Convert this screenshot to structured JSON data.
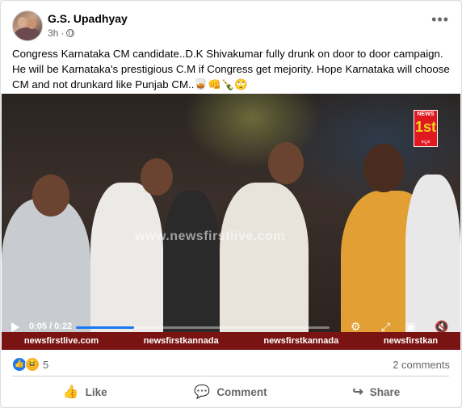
{
  "post": {
    "author": "G.S. Upadhyay",
    "time": "3h",
    "dot": "·",
    "text": "Congress Karnataka CM candidate..D.K Shivakumar fully drunk on door to door campaign. He will be Karnataka's prestigious C.M if Congress get mejority. Hope Karnataka will choose  CM and not drunkard like Punjab CM..🥃👊🍾🙄"
  },
  "video": {
    "watermark": "www.newsfirstlive.com",
    "logo_top": "NEWS",
    "logo_num": "1st",
    "logo_bottom": "ಕನ್ನಡ",
    "time": "0:05 / 0:22",
    "progress": 0.23,
    "ticker": [
      "newsfirstlive.com",
      "newsfirstkannada",
      "newsfirstkannada",
      "newsfirstkan"
    ]
  },
  "reactions": {
    "count": "5",
    "comments": "2 comments"
  },
  "actions": {
    "like": "Like",
    "comment": "Comment",
    "share": "Share"
  },
  "colors": {
    "accent": "#1877f2",
    "ticker": "#7a1412"
  },
  "icons": [
    "globe-icon",
    "more-options-icon",
    "play-icon",
    "settings-icon",
    "fullscreen-icon",
    "volume-icon",
    "like-icon",
    "comment-icon",
    "share-icon"
  ]
}
